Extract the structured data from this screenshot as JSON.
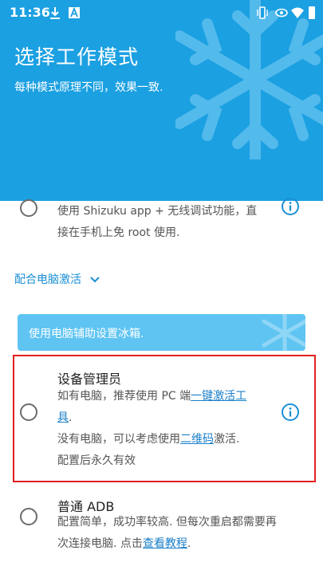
{
  "status_bar": {
    "time": "11:36",
    "left_icons": [
      "download-icon",
      "a-box-icon"
    ],
    "right_icons": [
      "vibrate-icon",
      "eye-icon",
      "wifi-icon",
      "signal-icon",
      "battery-icon"
    ]
  },
  "header": {
    "title": "选择工作模式",
    "subtitle": "每种模式原理不同，效果一致.",
    "background_color": "#1ba0e2"
  },
  "shizuku_option": {
    "desc_line1": "使用 Shizuku app + 无线调试功能，直",
    "desc_line2": "接在手机上免 root 使用."
  },
  "section": {
    "title": "配合电脑激活",
    "chevron": "chevron-down-icon",
    "banner": "使用电脑辅助设置冰箱."
  },
  "device_admin_option": {
    "title": "设备管理员",
    "line1_prefix": "如有电脑，推荐使用 PC 端",
    "line1_link": "一键激活工",
    "line2_link": "具",
    "line2_suffix": ".",
    "line3_prefix": "没有电脑，可以考虑使用",
    "line3_link": "二维码",
    "line3_suffix": "激活.",
    "line4": "配置后永久有效"
  },
  "adb_option": {
    "title": "普通 ADB",
    "line1": "配置简单，成功率较高. 但每次重启都需要再",
    "line2_prefix": "次连接电脑. 点击",
    "line2_link": "查看教程",
    "line2_suffix": "."
  },
  "colors": {
    "accent": "#1a8fd6",
    "banner": "#5fc4f2",
    "highlight": "#e02020",
    "link": "#1a7fc9"
  }
}
